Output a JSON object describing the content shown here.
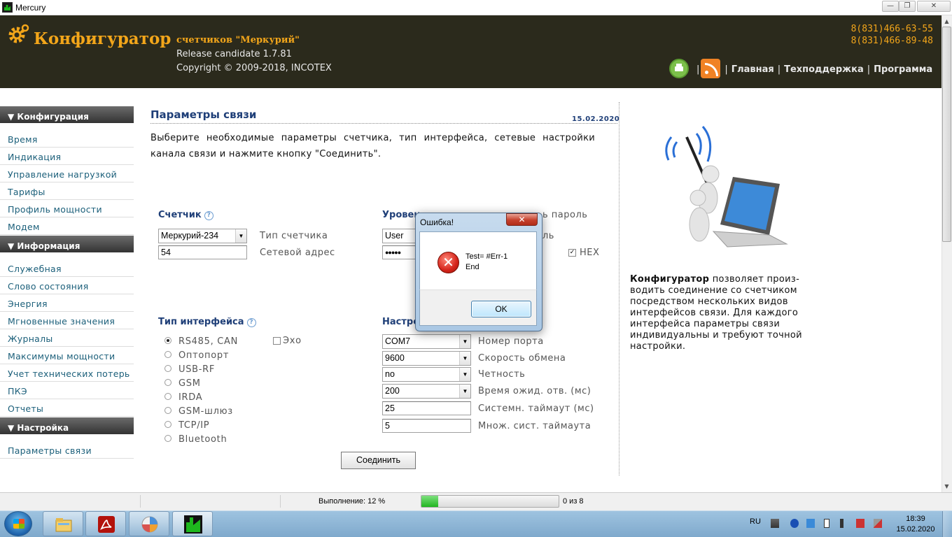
{
  "window": {
    "title": "Mercury",
    "min_glyph": "—",
    "max_glyph": "❐",
    "close_glyph": "✕"
  },
  "header": {
    "title": "Конфигуратор",
    "subtitle": "счетчиков \"Меркурий\"",
    "release": "Release candidate 1.7.81",
    "copyright": "Copyright © 2009-2018, INCOTEX",
    "phone1": "8(831)466-63-55",
    "phone2": "8(831)466-89-48",
    "separator": "|",
    "nav": [
      "Главная",
      "Техподдержка",
      "Программа"
    ],
    "accent_color": "#f3a61a"
  },
  "sidebar": {
    "sections": [
      {
        "title": "▼ Конфигурация",
        "items": [
          "Время",
          "Индикация",
          "Управление нагрузкой",
          "Тарифы",
          "Профиль мощности",
          "Модем"
        ]
      },
      {
        "title": "▼ Информация",
        "items": [
          "Служебная",
          "Слово состояния",
          "Энергия",
          "Мгновенные значения",
          "Журналы",
          "Максимумы мощности",
          "Учет технических потерь",
          "ПКЭ",
          "Отчеты"
        ]
      },
      {
        "title": "▼ Настройка",
        "items": [
          "Параметры связи"
        ]
      }
    ]
  },
  "main": {
    "title": "Параметры связи",
    "date": "15.02.2020",
    "description": "Выберите необходимые параметры счетчика, тип интерфейса, сетевые настройки канала связи и нажмите кнопку \"Соединить\".",
    "help_glyph": "?",
    "meter": {
      "group_label": "Счетчик",
      "type_value": "Меркурий-234",
      "type_label": "Тип счетчика",
      "address_value": "54",
      "address_label": "Сетевой адрес"
    },
    "access": {
      "group_label_partial": "Уровен",
      "show_password_label_partial": "ь пароль",
      "level_value": "User",
      "level_label_partial": "ль",
      "password_value": "●●●●●",
      "hex_label": "HEX",
      "hex_checked": true
    },
    "interface": {
      "group_label": "Тип интерфейса",
      "echo_label": "Эхо",
      "echo_checked": false,
      "selected": "RS485, CAN",
      "options": [
        "RS485, CAN",
        "Оптопорт",
        "USB-RF",
        "GSM",
        "IRDA",
        "GSM-шлюз",
        "TCP/IP",
        "Bluetooth"
      ]
    },
    "settings": {
      "group_label_partial": "Настро",
      "rows": [
        {
          "value": "COM7",
          "label": "Номер порта",
          "kind": "select"
        },
        {
          "value": "9600",
          "label": "Скорость обмена",
          "kind": "select"
        },
        {
          "value": "no",
          "label": "Четность",
          "kind": "select"
        },
        {
          "value": "200",
          "label": "Время ожид. отв. (мс)",
          "kind": "select"
        },
        {
          "value": "25",
          "label": "Системн. таймаут (мс)",
          "kind": "input"
        },
        {
          "value": "5",
          "label": "Множ. сист. таймаута",
          "kind": "input"
        }
      ]
    },
    "connect_label": "Соединить"
  },
  "side": {
    "text_bold": "Конфигуратор",
    "text_rest": " позволяет произ-водить соединение со счетчиком посредством нескольких видов интерфейсов связи. Для каждого интерфейса параметры связи индивидуальны и требуют точной настройки."
  },
  "status": {
    "progress_label": "Выполнение: 12 %",
    "progress_percent": 12,
    "count": "0 из 8"
  },
  "dialog": {
    "title": "Ошибка!",
    "close_glyph": "✕",
    "error_glyph": "✕",
    "line1": "Test= #Err-1",
    "line2": "End",
    "ok_label": "OK"
  },
  "taskbar": {
    "apps": [
      "explorer-icon",
      "pdf-reader-icon",
      "control-panel-icon",
      "mercury-app-icon"
    ],
    "lang": "RU",
    "time": "18:39",
    "date": "15.02.2020"
  }
}
